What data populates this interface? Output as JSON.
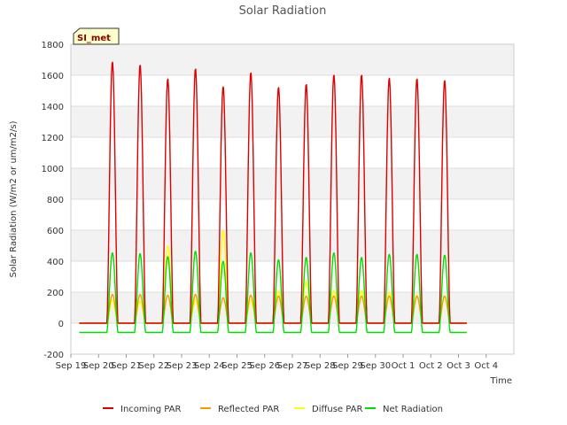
{
  "chart_data": {
    "type": "line",
    "title": "Solar Radiation",
    "xlabel": "Time",
    "ylabel": "Solar Radiation (W/m2 or um/m2/s)",
    "ylim": [
      -200,
      1800
    ],
    "yticks": [
      -200,
      0,
      200,
      400,
      600,
      800,
      1000,
      1200,
      1400,
      1600,
      1800
    ],
    "xlim": [
      0,
      16
    ],
    "xtick_labels": [
      "Sep 19",
      "Sep 20",
      "Sep 21",
      "Sep 22",
      "Sep 23",
      "Sep 24",
      "Sep 25",
      "Sep 26",
      "Sep 27",
      "Sep 28",
      "Sep 29",
      "Sep 30",
      "Oct 1",
      "Oct 2",
      "Oct 3",
      "Oct 4"
    ],
    "station_label": "SI_met",
    "grid": "horizontal bands",
    "legend_position": "bottom",
    "days": [
      "Sep 19",
      "Sep 20",
      "Sep 21",
      "Sep 22",
      "Sep 23",
      "Sep 24",
      "Sep 25",
      "Sep 26",
      "Sep 27",
      "Sep 28",
      "Sep 29",
      "Sep 30",
      "Oct 1",
      "Oct 2",
      "Oct 3"
    ],
    "series": [
      {
        "name": "Incoming PAR",
        "color": "#dd0000",
        "daily_peak": [
          1690,
          1670,
          1580,
          1645,
          1530,
          1620,
          1525,
          1545,
          1605,
          1605,
          1585,
          1580,
          1570,
          1550
        ]
      },
      {
        "name": "Reflected PAR",
        "color": "#ff9900",
        "daily_peak": [
          185,
          185,
          180,
          185,
          165,
          180,
          175,
          175,
          175,
          175,
          175,
          175,
          175,
          175
        ]
      },
      {
        "name": "Diffuse PAR",
        "color": "#ffff00",
        "daily_peak": [
          150,
          140,
          500,
          150,
          600,
          150,
          210,
          270,
          210,
          210,
          200,
          180,
          170,
          170
        ]
      },
      {
        "name": "Net Radiation",
        "color": "#00dd00",
        "daily_peak": [
          455,
          450,
          430,
          465,
          400,
          455,
          410,
          425,
          455,
          425,
          445,
          445,
          440,
          435
        ],
        "night_value": -60
      }
    ]
  }
}
